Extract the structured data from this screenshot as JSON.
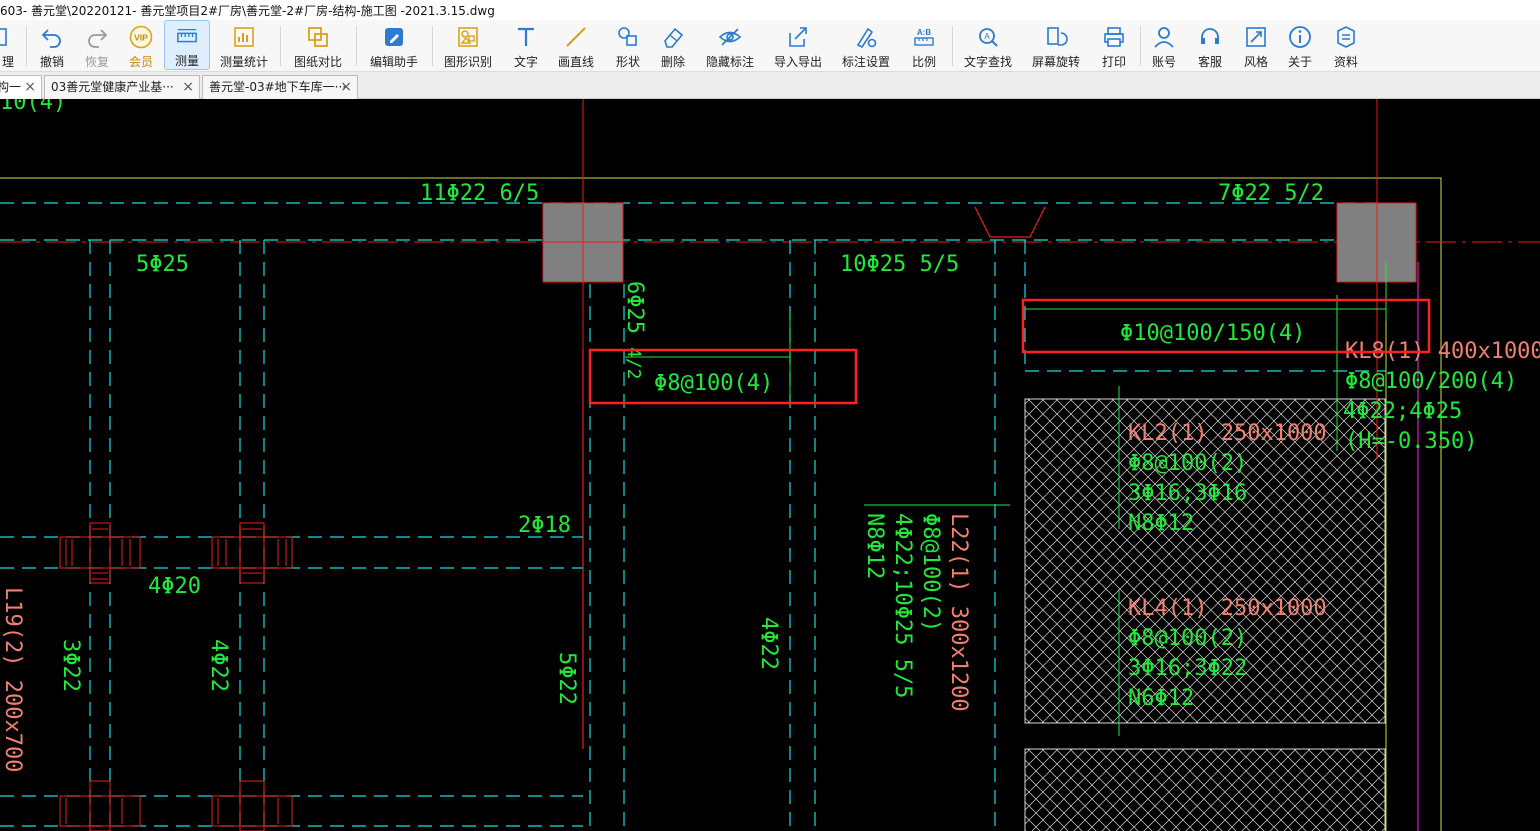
{
  "window": {
    "title": "603- 善元堂\\20220121- 善元堂项目2#厂房\\善元堂-2#厂房-结构-施工图 -2021.3.15.dwg"
  },
  "toolbar": {
    "items": [
      {
        "label": "理",
        "icon": "manage-icon"
      },
      {
        "label": "撤销",
        "icon": "undo-icon"
      },
      {
        "label": "恢复",
        "icon": "redo-icon"
      },
      {
        "label": "会员",
        "icon": "vip-icon"
      },
      {
        "label": "测量",
        "icon": "measure-icon"
      },
      {
        "label": "测量统计",
        "icon": "measure-stats-icon"
      },
      {
        "label": "图纸对比",
        "icon": "compare-icon"
      },
      {
        "label": "编辑助手",
        "icon": "edit-assistant-icon"
      },
      {
        "label": "图形识别",
        "icon": "shape-recognition-icon"
      },
      {
        "label": "文字",
        "icon": "text-icon"
      },
      {
        "label": "画直线",
        "icon": "line-icon"
      },
      {
        "label": "形状",
        "icon": "shape-icon"
      },
      {
        "label": "删除",
        "icon": "eraser-icon"
      },
      {
        "label": "隐藏标注",
        "icon": "hide-eye-icon"
      },
      {
        "label": "导入导出",
        "icon": "import-export-icon"
      },
      {
        "label": "标注设置",
        "icon": "annotation-settings-icon"
      },
      {
        "label": "比例",
        "icon": "scale-icon"
      },
      {
        "label": "文字查找",
        "icon": "text-search-icon"
      },
      {
        "label": "屏幕旋转",
        "icon": "rotate-screen-icon"
      },
      {
        "label": "打印",
        "icon": "print-icon"
      },
      {
        "label": "账号",
        "icon": "account-icon"
      },
      {
        "label": "客服",
        "icon": "headset-icon"
      },
      {
        "label": "风格",
        "icon": "style-icon"
      },
      {
        "label": "关于",
        "icon": "info-icon"
      },
      {
        "label": "资料",
        "icon": "documents-icon"
      }
    ],
    "vip_badge": "VIP",
    "scale_badge": "A:B"
  },
  "tabs": [
    {
      "label": "构一",
      "close": "×"
    },
    {
      "label": "03善元堂健康产业基···",
      "close": "×"
    },
    {
      "label": "善元堂-03#地下车库一···",
      "close": "×"
    }
  ],
  "drawing": {
    "top_partial": "10(4)",
    "rebar_labels": {
      "top_left": "11Φ22 6/5",
      "top_right": "7Φ22 5/2",
      "beam_5phi25": "5Φ25",
      "beam_10phi25": "10Φ25 5/5",
      "vertical_6phi25": "6Φ25",
      "vertical_4_2": "4/2",
      "two_phi18": "2Φ18",
      "four_phi20": "4Φ20",
      "l19": "L19(2) 200x700",
      "three_phi22": "3Φ22",
      "four_phi22_a": "4Φ22",
      "five_phi22": "5Φ22",
      "four_phi22_b": "4Φ22",
      "l22_line1": "L22(1) 300x1200",
      "l22_line2": "Φ8@100(2)",
      "l22_line3": "4Φ22;10Φ25 5/5",
      "l22_line4": "N8Φ12"
    },
    "highlight_1": "Φ8@100(4)",
    "highlight_2": "Φ10@100/150(4)",
    "kl8": [
      "KL8(1) 400x1000",
      "Φ8@100/200(4)",
      "4Φ22;4Φ25",
      "(H=-0.350)"
    ],
    "kl2": [
      "KL2(1) 250x1000",
      "Φ8@100(2)",
      "3Φ16;3Φ16",
      "N8Φ12"
    ],
    "kl4": [
      "KL4(1) 250x1000",
      "Φ8@100(2)",
      "3Φ16;3Φ22",
      "N6Φ12"
    ],
    "colors": {
      "green": "#22e83a",
      "cyan": "#19dcdc",
      "red": "#ee1c1c",
      "salmon": "#f08070",
      "magenta": "#d020d0",
      "column_fill": "#808080",
      "highlight_box": "#ff2020",
      "yellow_green": "#c8e040"
    }
  }
}
